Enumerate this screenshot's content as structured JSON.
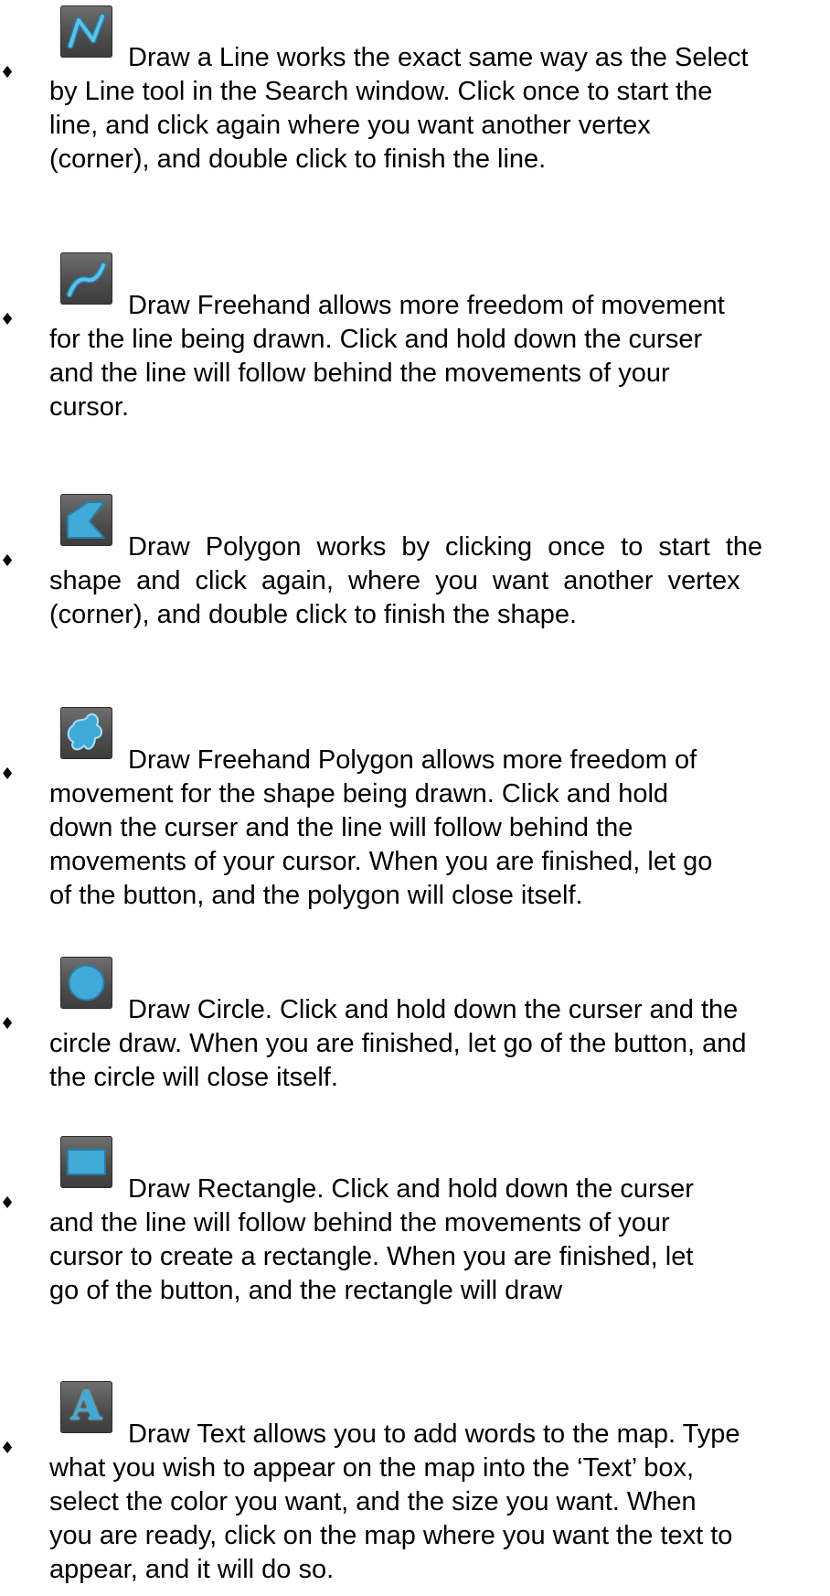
{
  "tools": [
    {
      "icon": "draw-line-icon",
      "lines": [
        "Draw a Line works the exact same way as the Select",
        "by Line tool in the Search window. Click once to start the",
        "line, and click again where you want another vertex",
        "(corner), and double click to finish the line."
      ]
    },
    {
      "icon": "draw-freehand-icon",
      "lines": [
        "Draw Freehand allows more freedom of movement",
        "for the line being drawn. Click and hold down the curser",
        "and the line will follow behind the movements of your",
        "cursor."
      ]
    },
    {
      "icon": "draw-polygon-icon",
      "lines": [
        "Draw Polygon works by clicking once to start the",
        "shape and click again, where you want another vertex",
        "(corner), and double click to finish the shape."
      ]
    },
    {
      "icon": "draw-freehand-polygon-icon",
      "lines": [
        "Draw Freehand Polygon allows more freedom of",
        "movement for the shape being drawn. Click and hold",
        "down the curser and the line will follow behind the",
        "movements of your cursor. When you are finished, let go",
        "of the button, and the polygon will close itself."
      ]
    },
    {
      "icon": "draw-circle-icon",
      "lines": [
        "Draw Circle. Click and hold down the curser and the",
        "circle draw. When you are finished, let go of the button, and",
        "the circle will close itself."
      ]
    },
    {
      "icon": "draw-rectangle-icon",
      "lines": [
        "Draw Rectangle. Click and hold down the curser",
        "and the line will follow behind the movements of your",
        "cursor to create a rectangle. When you are finished, let",
        "go of the button, and the rectangle will draw"
      ]
    },
    {
      "icon": "draw-text-icon",
      "icon_letter": "A",
      "lines": [
        "Draw Text allows you to add words to the map.  Type",
        "what you wish to appear on the map into the ‘Text’ box,",
        "select the color you want, and the size you want.  When",
        "you are ready, click on the map where you want the text to",
        "appear, and it will do so."
      ]
    }
  ],
  "bullet_glyph": "♦",
  "colors": {
    "icon_accent": "#3fa9d8",
    "icon_bg": "#565656"
  }
}
